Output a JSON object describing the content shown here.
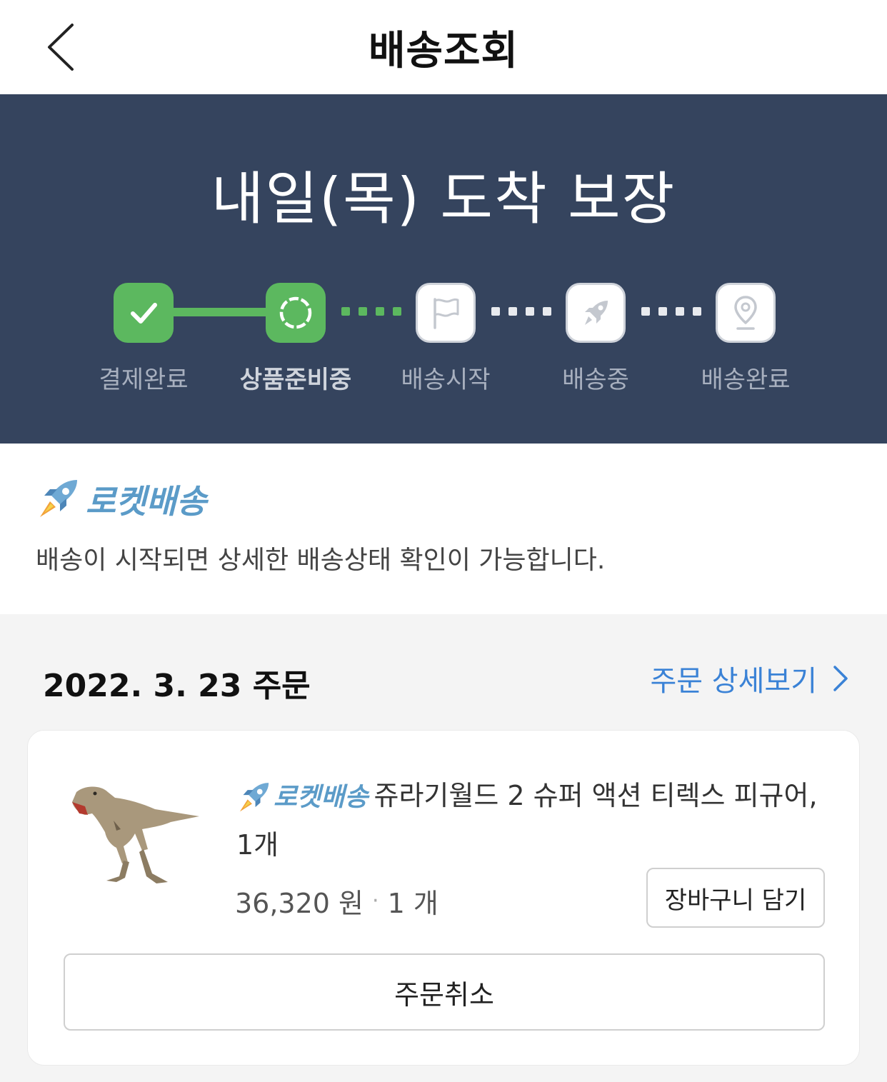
{
  "header": {
    "title": "배송조회",
    "back_icon": "chevron-left-icon"
  },
  "status": {
    "eta": "내일(목) 도착 보장",
    "steps": [
      {
        "label": "결제완료",
        "icon": "check-icon",
        "state": "done"
      },
      {
        "label": "상품준비중",
        "icon": "loading-ring-icon",
        "state": "current"
      },
      {
        "label": "배송시작",
        "icon": "flag-icon",
        "state": "todo"
      },
      {
        "label": "배송중",
        "icon": "rocket-icon",
        "state": "todo"
      },
      {
        "label": "배송완료",
        "icon": "location-pin-icon",
        "state": "todo"
      }
    ],
    "colors": {
      "banner": "#35445e",
      "active": "#5cb85f"
    }
  },
  "rocket": {
    "badge": "로켓배송",
    "description": "배송이 시작되면 상세한 배송상태 확인이 가능합니다."
  },
  "order": {
    "date": "2022. 3. 23 주문",
    "detail_link": "주문 상세보기",
    "item": {
      "badge": "로켓배송",
      "name": "쥬라기월드 2 슈퍼 액션 티렉스 피규어, 1개",
      "price": "36,320 원",
      "quantity": "1 개",
      "add_to_cart": "장바구니 담기"
    },
    "cancel": "주문취소"
  }
}
